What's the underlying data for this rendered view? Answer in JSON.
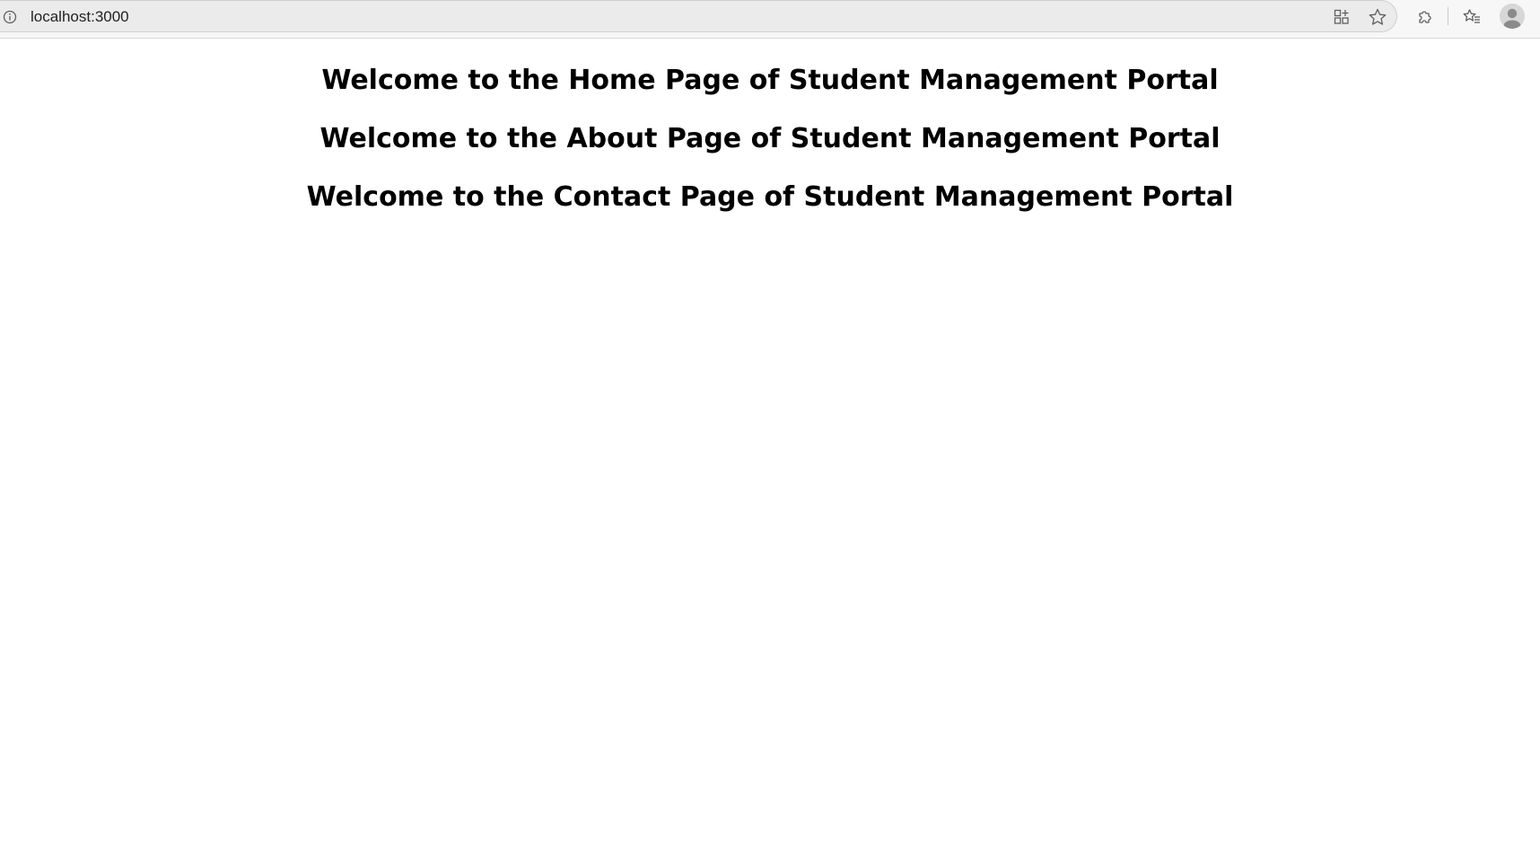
{
  "browser": {
    "url": "localhost:3000",
    "icons": {
      "site_info": "info-icon",
      "app_view": "app-available-icon",
      "favorite": "star-icon",
      "extensions": "puzzle-icon",
      "favorites_bar": "favorites-list-icon",
      "profile": "profile-avatar-icon"
    }
  },
  "page": {
    "headings": [
      "Welcome to the Home Page of Student Management Portal",
      "Welcome to the About Page of Student Management Portal",
      "Welcome to the Contact Page of Student Management Portal"
    ]
  },
  "colors": {
    "toolbar_bg": "#f7f7f7",
    "address_bg": "#ebebeb",
    "text": "#000000",
    "icon": "#5f5f5f"
  }
}
